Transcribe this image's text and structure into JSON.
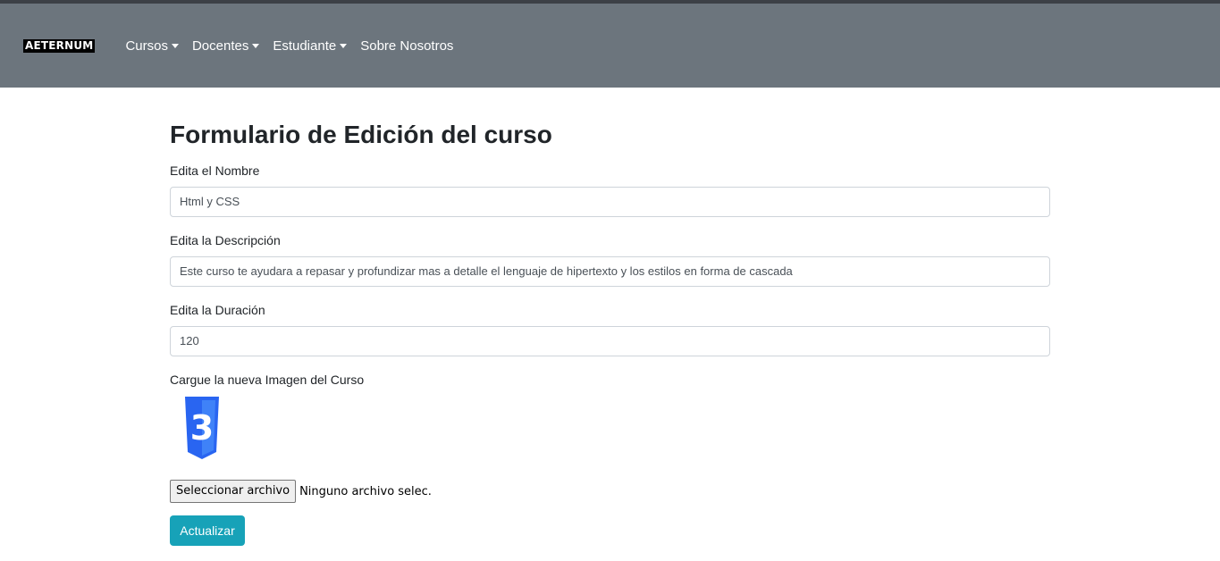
{
  "navbar": {
    "brand": "AETERNUM",
    "items": [
      {
        "label": "Cursos",
        "dropdown": true
      },
      {
        "label": "Docentes",
        "dropdown": true
      },
      {
        "label": "Estudiante",
        "dropdown": true
      },
      {
        "label": "Sobre Nosotros",
        "dropdown": false
      }
    ]
  },
  "form": {
    "title": "Formulario de Edición del curso",
    "nombre_label": "Edita el Nombre",
    "nombre_value": "Html y CSS",
    "descripcion_label": "Edita la Descripción",
    "descripcion_value": "Este curso te ayudara a repasar y profundizar mas a detalle el lenguaje de hipertexto y los estilos en forma de cascada",
    "duracion_label": "Edita la Duración",
    "duracion_value": "120",
    "imagen_label": "Cargue la nueva Imagen del Curso",
    "imagen_icon": "css3-logo-icon",
    "file_button_label": "Seleccionar archivo",
    "file_status": "Ninguno archivo selec.",
    "submit_label": "Actualizar"
  },
  "colors": {
    "navbar_bg": "#6c757d",
    "submit_bg": "#17a2b8",
    "css3_blue": "#2965f1"
  }
}
